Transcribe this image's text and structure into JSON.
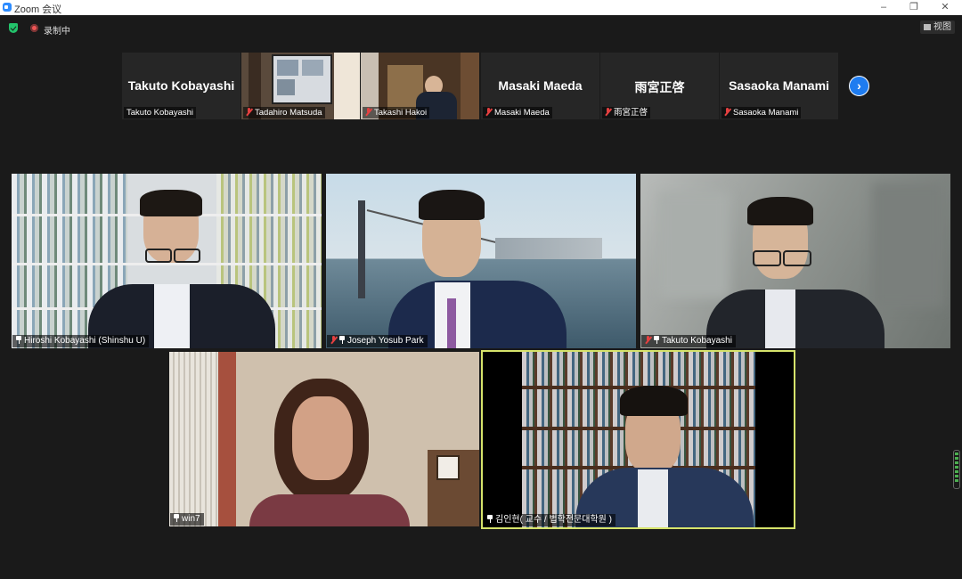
{
  "window": {
    "title": "Zoom 会议",
    "controls": [
      "–",
      "❐",
      "✕"
    ]
  },
  "infobar": {
    "recording_label": "录制中",
    "view_label": "视图"
  },
  "thumbnails": [
    {
      "display_name": "Takuto Kobayashi",
      "label": "Takuto Kobayashi",
      "muted": false,
      "video": false
    },
    {
      "display_name": "",
      "label": "Tadahiro Matsuda",
      "muted": true,
      "video": true
    },
    {
      "display_name": "",
      "label": "Takashi Hakoi",
      "muted": true,
      "video": true
    },
    {
      "display_name": "Masaki Maeda",
      "label": "Masaki Maeda",
      "muted": true,
      "video": false
    },
    {
      "display_name": "雨宮正啓",
      "label": "雨宮正啓",
      "muted": true,
      "video": false
    },
    {
      "display_name": "Sasaoka Manami",
      "label": "Sasaoka Manami",
      "muted": true,
      "video": false
    }
  ],
  "next_page_icon": "chevron-right-icon",
  "gallery": [
    {
      "label": "Hiroshi Kobayashi (Shinshu U)",
      "muted": false,
      "pinned": true
    },
    {
      "label": "Joseph Yosub Park",
      "muted": true,
      "pinned": true
    },
    {
      "label": "Takuto Kobayashi",
      "muted": true,
      "pinned": true
    },
    {
      "label": "win7",
      "muted": false,
      "pinned": true
    },
    {
      "label": "김인현( 교수 / 법학전문대학원 )",
      "muted": false,
      "pinned": true,
      "active_speaker": true
    }
  ],
  "colors": {
    "accent": "#1e7cf0",
    "active_speaker_border": "#d6e36b",
    "muted": "#e54040",
    "secure": "#23c36b"
  }
}
